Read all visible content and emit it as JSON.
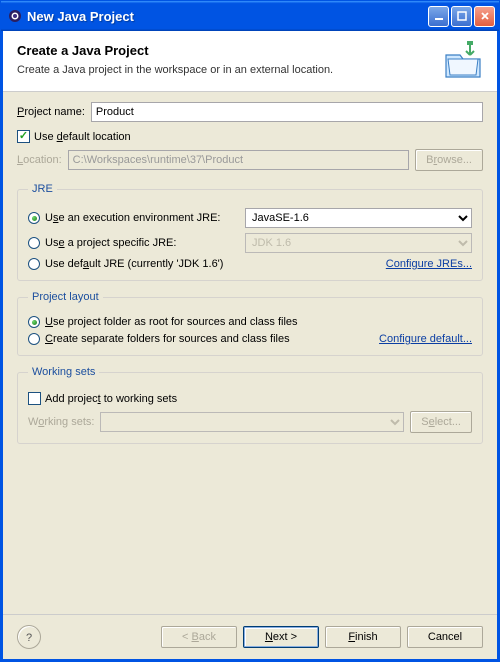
{
  "window": {
    "title": "New Java Project",
    "heading": "Create a Java Project",
    "subheading": "Create a Java project in the workspace or in an external location."
  },
  "project": {
    "name_label": "Project name:",
    "name_value": "Product",
    "use_default_label": "Use default location",
    "use_default_checked": true,
    "location_label": "Location:",
    "location_value": "C:\\Workspaces\\runtime\\37\\Product",
    "browse_label": "Browse..."
  },
  "jre": {
    "legend": "JRE",
    "opt_exec_env": "Use an execution environment JRE:",
    "exec_env_value": "JavaSE-1.6",
    "opt_project_specific": "Use a project specific JRE:",
    "project_specific_value": "JDK 1.6",
    "opt_default": "Use default JRE (currently 'JDK 1.6')",
    "configure_link": "Configure JREs...",
    "selected": "exec_env"
  },
  "layout": {
    "legend": "Project layout",
    "opt_root": "Use project folder as root for sources and class files",
    "opt_separate": "Create separate folders for sources and class files",
    "configure_link": "Configure default...",
    "selected": "root"
  },
  "working_sets": {
    "legend": "Working sets",
    "add_label": "Add project to working sets",
    "add_checked": false,
    "ws_label": "Working sets:",
    "select_label": "Select..."
  },
  "buttons": {
    "back": "< Back",
    "next": "Next >",
    "finish": "Finish",
    "cancel": "Cancel"
  }
}
